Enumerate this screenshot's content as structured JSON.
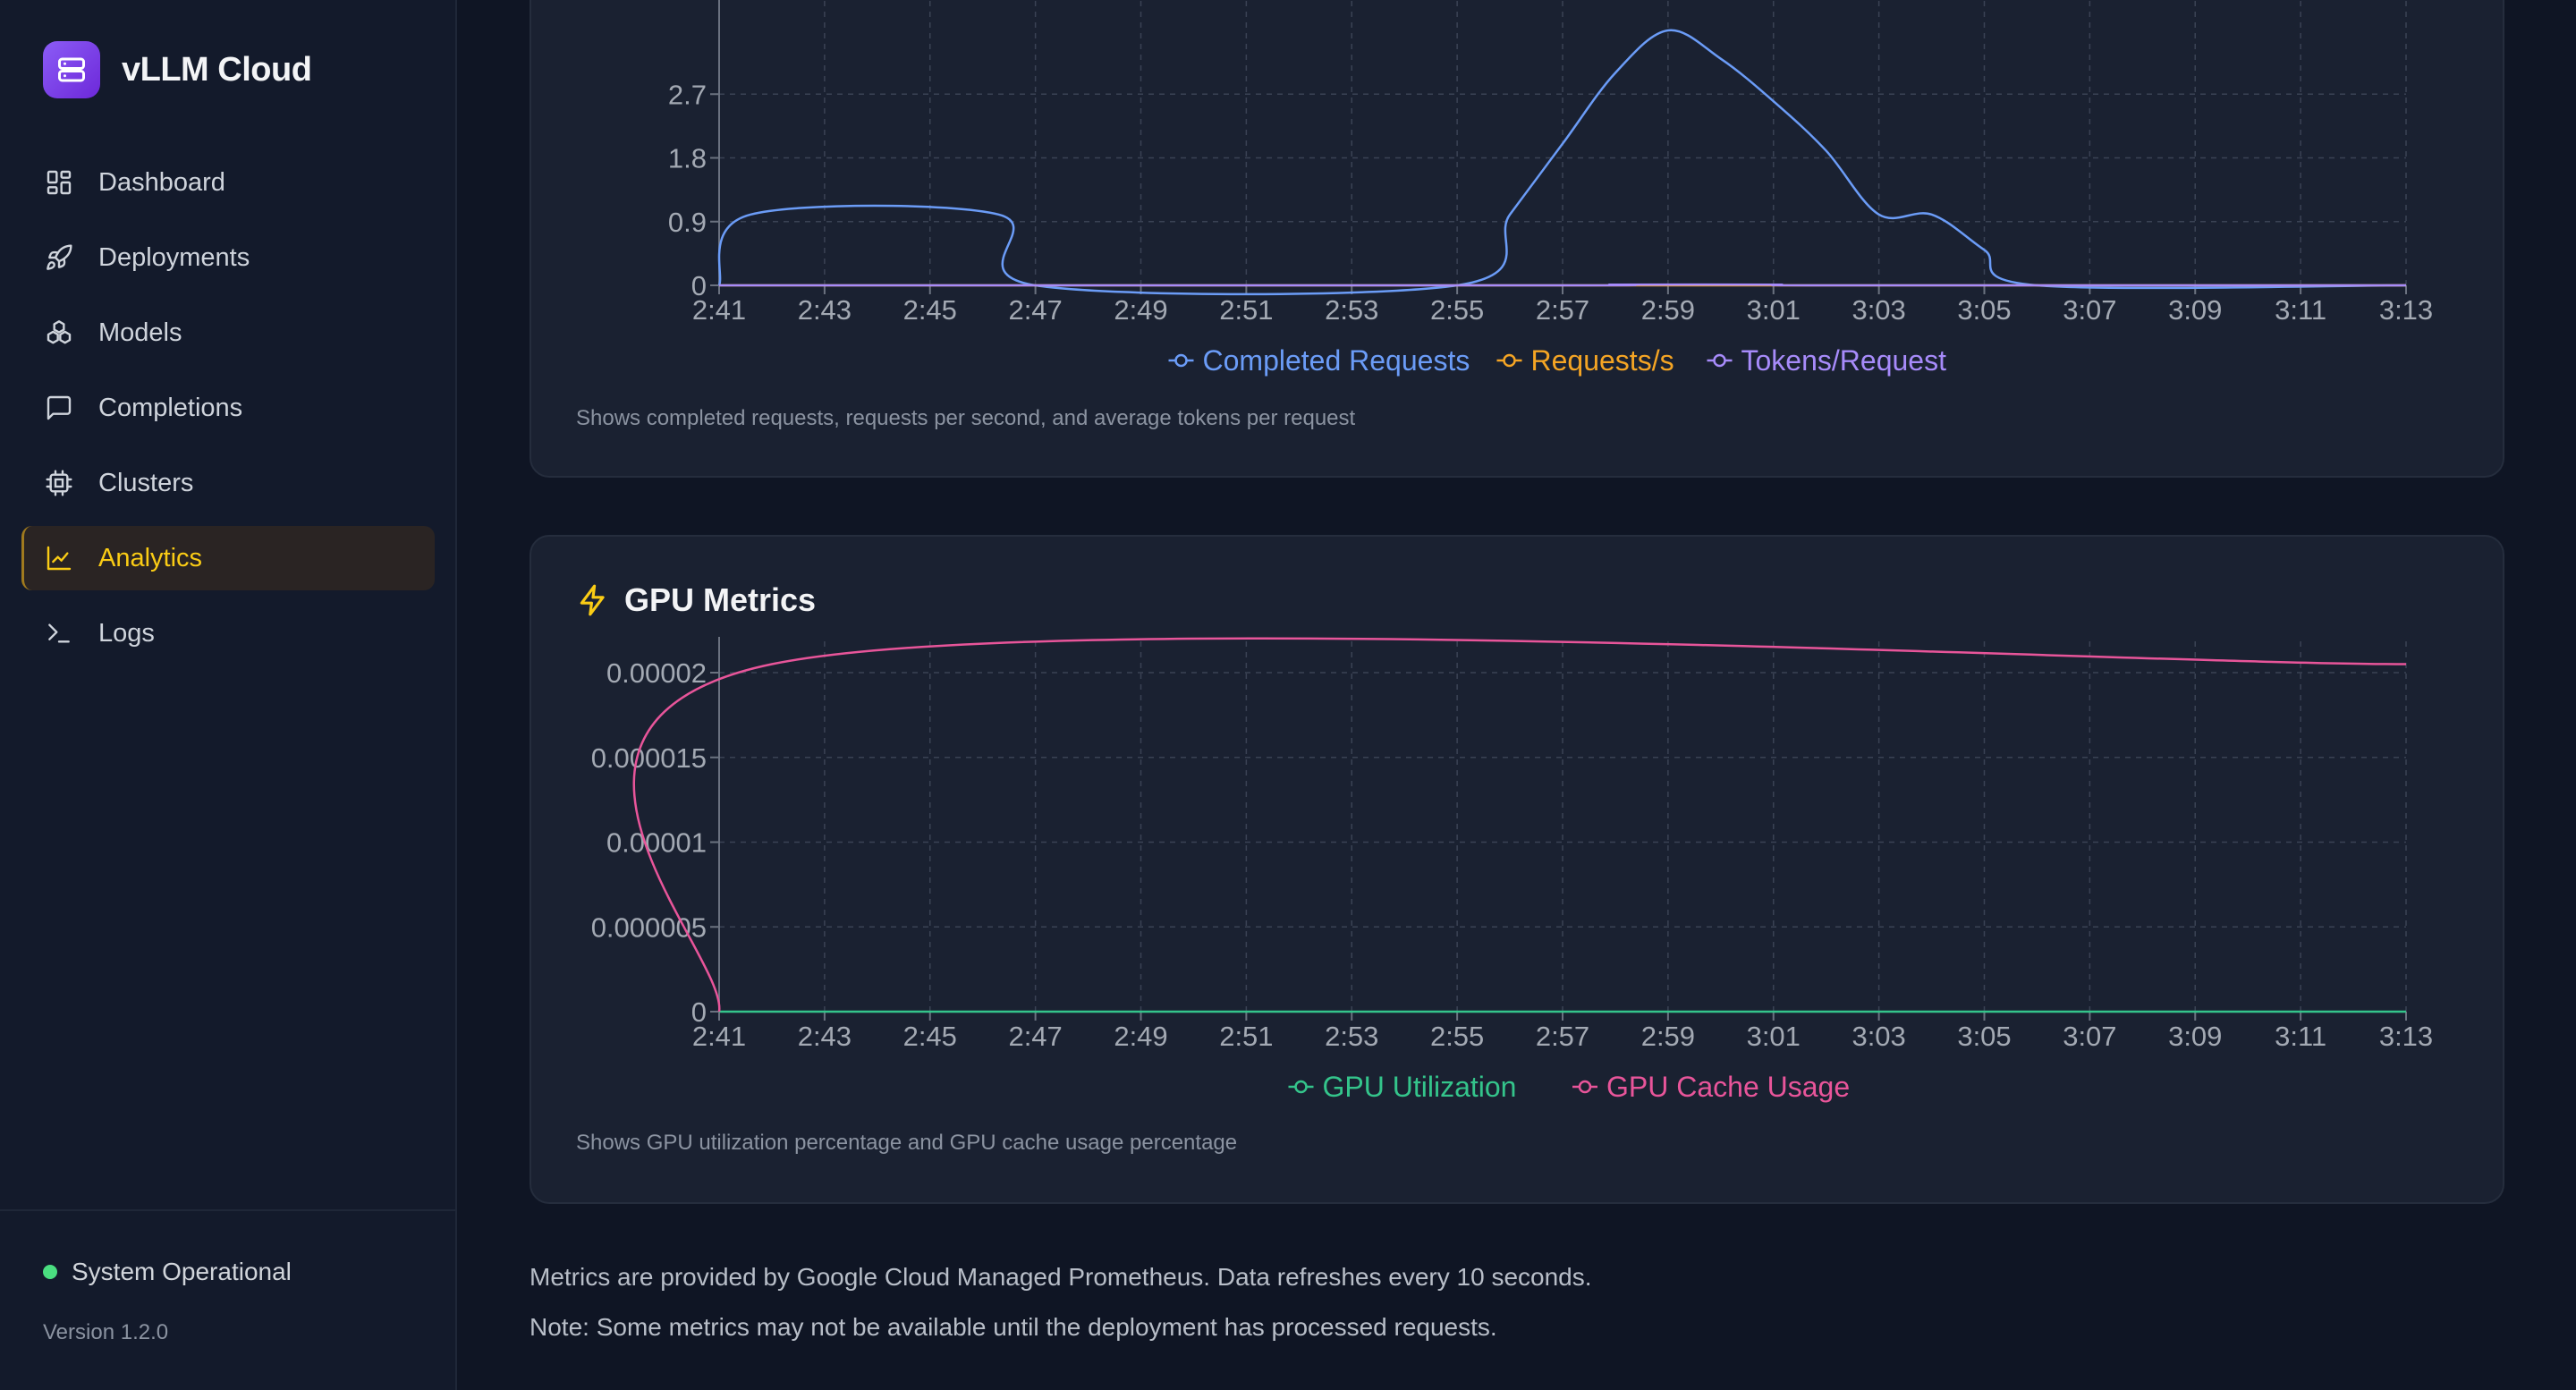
{
  "app": {
    "name": "vLLM Cloud"
  },
  "nav": [
    {
      "label": "Dashboard",
      "icon": "dashboard-icon",
      "active": false
    },
    {
      "label": "Deployments",
      "icon": "rocket-icon",
      "active": false
    },
    {
      "label": "Models",
      "icon": "models-icon",
      "active": false
    },
    {
      "label": "Completions",
      "icon": "message-icon",
      "active": false
    },
    {
      "label": "Clusters",
      "icon": "cpu-icon",
      "active": false
    },
    {
      "label": "Analytics",
      "icon": "chart-line-icon",
      "active": true
    },
    {
      "label": "Logs",
      "icon": "terminal-icon",
      "active": false
    }
  ],
  "footer": {
    "status": "System Operational",
    "version": "Version 1.2.0"
  },
  "colors": {
    "completed": "#6b9cf7",
    "requests_per_s": "#f5a524",
    "tokens_per_request": "#a78bfa",
    "gpu_util": "#34c48b",
    "gpu_cache": "#e8559a",
    "accent": "#facc15"
  },
  "requests_card": {
    "description": "Shows completed requests, requests per second, and average tokens per request"
  },
  "gpu_card": {
    "title": "GPU Metrics",
    "icon": "lightning-icon",
    "description": "Shows GPU utilization percentage and GPU cache usage percentage"
  },
  "footnotes": {
    "line1": "Metrics are provided by Google Cloud Managed Prometheus. Data refreshes every 10 seconds.",
    "line2": "Note: Some metrics may not be available until the deployment has processed requests."
  },
  "chart_data": [
    {
      "type": "line",
      "x_ticks": [
        "2:41",
        "2:43",
        "2:45",
        "2:47",
        "2:49",
        "2:51",
        "2:53",
        "2:55",
        "2:57",
        "2:59",
        "3:01",
        "3:03",
        "3:05",
        "3:07",
        "3:09",
        "3:11",
        "3:13"
      ],
      "y_ticks": [
        0,
        0.9,
        1.8,
        2.7
      ],
      "ylim": [
        0,
        3.6
      ],
      "grid": true,
      "legend_position": "bottom",
      "series": [
        {
          "name": "Completed Requests",
          "points": [
            [
              "2:41",
              0
            ],
            [
              "2:41.6",
              1
            ],
            [
              "2:46.3",
              1
            ],
            [
              "2:47",
              0
            ],
            [
              "2:55",
              0
            ],
            [
              "2:56",
              1
            ],
            [
              "2:57",
              2
            ],
            [
              "2:58",
              3
            ],
            [
              "2:59",
              3.6
            ],
            [
              "3:00",
              3.2
            ],
            [
              "3:01",
              2.6
            ],
            [
              "3:02",
              1.9
            ],
            [
              "3:03",
              1
            ],
            [
              "3:04",
              1
            ],
            [
              "3:05",
              0.5
            ],
            [
              "3:06",
              0
            ],
            [
              "3:13",
              0
            ]
          ]
        },
        {
          "name": "Requests/s",
          "points": [
            [
              "2:41",
              0
            ],
            [
              "3:13",
              0
            ]
          ]
        },
        {
          "name": "Tokens/Request",
          "points": [
            [
              "2:41",
              0
            ],
            [
              "2:57",
              0
            ],
            [
              "2:58",
              0.01
            ],
            [
              "3:01",
              0.01
            ],
            [
              "3:02",
              0
            ],
            [
              "3:13",
              0
            ]
          ]
        }
      ]
    },
    {
      "type": "line",
      "title": "GPU Metrics",
      "x_ticks": [
        "2:41",
        "2:43",
        "2:45",
        "2:47",
        "2:49",
        "2:51",
        "2:53",
        "2:55",
        "2:57",
        "2:59",
        "3:01",
        "3:03",
        "3:05",
        "3:07",
        "3:09",
        "3:11",
        "3:13"
      ],
      "y_ticks": [
        "0",
        "0.000005",
        "0.00001",
        "0.000015",
        "0.00002"
      ],
      "ylim": [
        0,
        2e-05
      ],
      "grid": true,
      "legend_position": "bottom",
      "series": [
        {
          "name": "GPU Utilization",
          "points": [
            [
              "2:41",
              0
            ],
            [
              "3:13",
              0
            ]
          ]
        },
        {
          "name": "GPU Cache Usage",
          "points": [
            [
              "2:41",
              0
            ],
            [
              "2:42",
              2.05e-05
            ],
            [
              "3:13",
              2.05e-05
            ]
          ]
        }
      ]
    }
  ]
}
